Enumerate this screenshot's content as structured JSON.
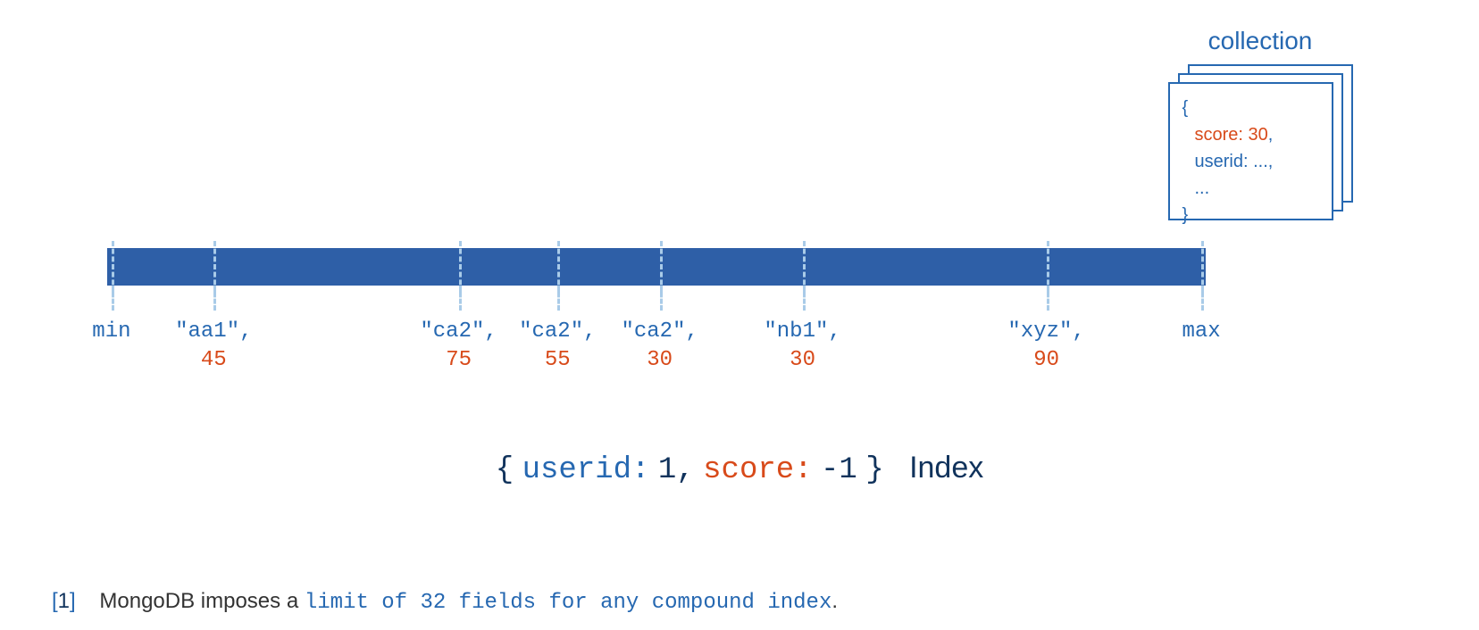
{
  "collection": {
    "label": "collection",
    "document": {
      "open": "{",
      "score_key": "score:",
      "score_value": "30",
      "comma": ",",
      "userid_line": "userid: ...,",
      "ellipsis": "...",
      "close": "}"
    }
  },
  "bar": {
    "min_label": "min",
    "max_label": "max",
    "entries": [
      {
        "key": "\"aa1\",",
        "value": "45",
        "pos": 9.7
      },
      {
        "key": "\"ca2\",",
        "value": "75",
        "pos": 32
      },
      {
        "key": "\"ca2\",",
        "value": "55",
        "pos": 41
      },
      {
        "key": "\"ca2\",",
        "value": "30",
        "pos": 50.3
      },
      {
        "key": "\"nb1\",",
        "value": "30",
        "pos": 63.3
      },
      {
        "key": "\"xyz\",",
        "value": "90",
        "pos": 85.5
      }
    ]
  },
  "index_definition": {
    "open": "{",
    "userid_key": "userid:",
    "userid_val": "1",
    "comma": ",",
    "score_key": "score:",
    "score_val": "-1",
    "close": "}",
    "label": "Index"
  },
  "footnote": {
    "ref": "1",
    "prefix": "MongoDB imposes a ",
    "link": "limit of 32 fields for any compound index",
    "suffix": "."
  }
}
